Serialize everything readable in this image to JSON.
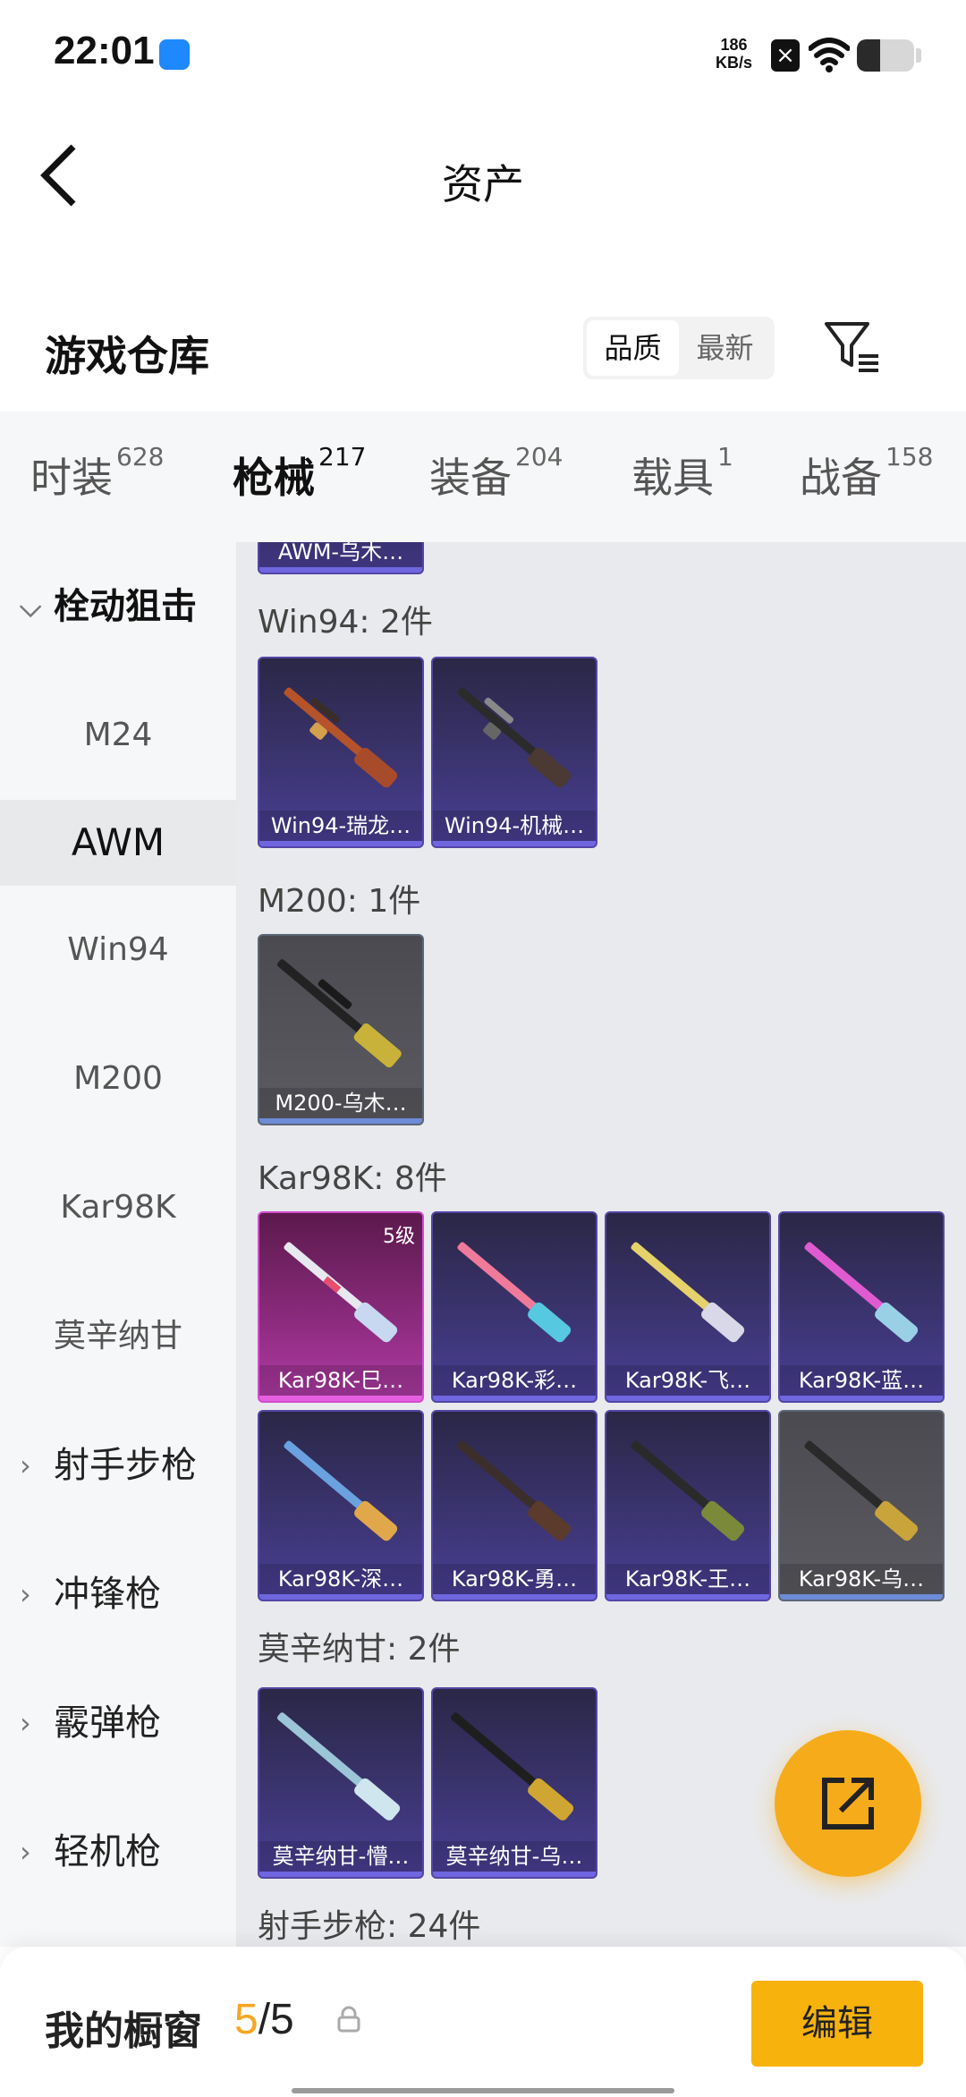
{
  "status_bar": {
    "time": "22:01",
    "net_speed_value": "186",
    "net_speed_unit": "KB/s",
    "battery_level": 0.4
  },
  "nav": {
    "title": "资产"
  },
  "warehouse": {
    "title": "游戏仓库",
    "sort_options": [
      "品质",
      "最新"
    ],
    "selected_sort": "品质"
  },
  "tabs": [
    {
      "label": "时装",
      "count": "628"
    },
    {
      "label": "枪械",
      "count": "217"
    },
    {
      "label": "装备",
      "count": "204"
    },
    {
      "label": "载具",
      "count": "1"
    },
    {
      "label": "战备",
      "count": "158"
    }
  ],
  "sidebar": {
    "group_open": "栓动狙击",
    "sub_items": [
      "M24",
      "AWM",
      "Win94",
      "M200",
      "Kar98K",
      "莫辛纳甘"
    ],
    "selected": "AWM",
    "groups": [
      "射手步枪",
      "冲锋枪",
      "霰弹枪",
      "轻机枪"
    ]
  },
  "main": {
    "partial_card_label": "AWM-乌木…",
    "sections": [
      {
        "title": "Win94: 2件",
        "items": [
          "Win94-瑞龙…",
          "Win94-机械…"
        ]
      },
      {
        "title": "M200: 1件",
        "items": [
          "M200-乌木…"
        ]
      },
      {
        "title": "Kar98K: 8件",
        "items": [
          "Kar98K-巳…",
          "Kar98K-彩…",
          "Kar98K-飞…",
          "Kar98K-蓝…",
          "Kar98K-深…",
          "Kar98K-勇…",
          "Kar98K-王…",
          "Kar98K-乌…"
        ],
        "level_badge": "5级"
      },
      {
        "title": "莫辛纳甘: 2件",
        "items": [
          "莫辛纳甘-懵…",
          "莫辛纳甘-乌…"
        ]
      },
      {
        "title": "射手步枪: 24件"
      }
    ]
  },
  "bottom_bar": {
    "title": "我的橱窗",
    "current": "5",
    "separator": "/",
    "total": "5",
    "edit_label": "编辑"
  },
  "colors": {
    "accent": "#f5a623",
    "edit_button": "#f7b20c",
    "fab": "#f6ab1a",
    "purple_card": "#3b3470",
    "gray_card": "#5b5b61",
    "pink_card": "#8a2a7c"
  },
  "icons": [
    "back-arrow-icon",
    "filter-icon",
    "share-export-icon",
    "lock-icon",
    "wifi-icon",
    "battery-icon",
    "chevron-down-icon",
    "chevron-right-icon"
  ]
}
